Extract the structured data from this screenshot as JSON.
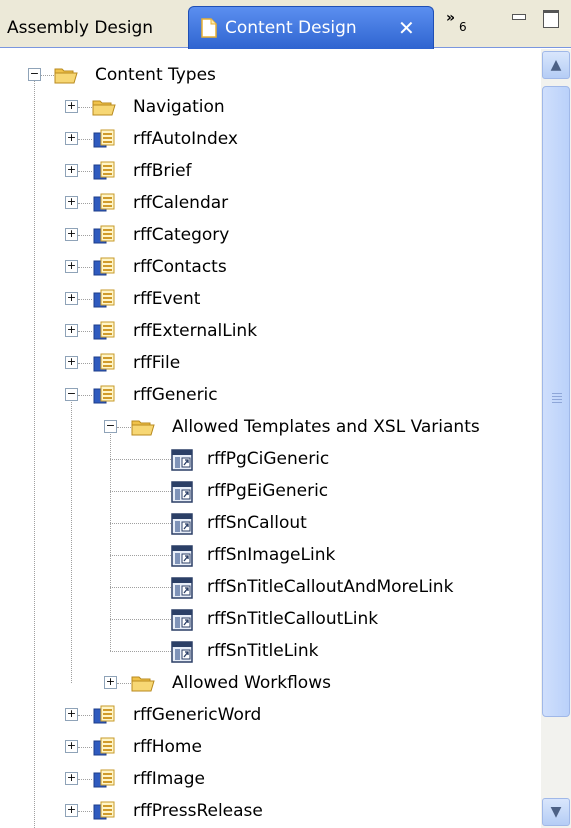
{
  "tabs": {
    "inactive_label": "Assembly Design",
    "active_label": "Content Design",
    "close_glyph": "✕",
    "overflow_glyph": "»",
    "overflow_count": "6"
  },
  "tree": {
    "root": "Content Types",
    "navigation": "Navigation",
    "types_top": [
      "rffAutoIndex",
      "rffBrief",
      "rffCalendar",
      "rffCategory",
      "rffContacts",
      "rffEvent",
      "rffExternalLink",
      "rffFile"
    ],
    "generic": "rffGeneric",
    "allowed_templates": "Allowed Templates and XSL Variants",
    "templates": [
      "rffPgCiGeneric",
      "rffPgEiGeneric",
      "rffSnCallout",
      "rffSnImageLink",
      "rffSnTitleCalloutAndMoreLink",
      "rffSnTitleCalloutLink",
      "rffSnTitleLink"
    ],
    "allowed_workflows": "Allowed Workflows",
    "types_bottom": [
      "rffGenericWord",
      "rffHome",
      "rffImage",
      "rffPressRelease"
    ]
  },
  "scrollbar": {
    "up_glyph": "▲",
    "down_glyph": "▼"
  },
  "colors": {
    "active_tab": "#3c73d9",
    "folder": "#f5cd5c",
    "content_type_icon": "#2f5bbf",
    "scrollbar_thumb": "#c3d7fb"
  }
}
